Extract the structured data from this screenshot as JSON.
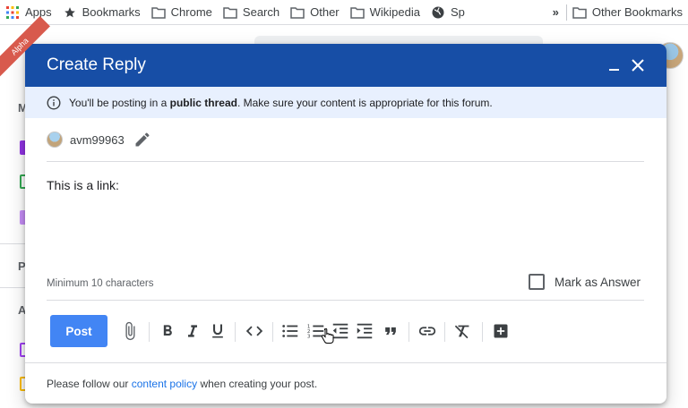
{
  "bookmarks": {
    "items": [
      {
        "label": "Apps",
        "icon": "apps-grid-icon"
      },
      {
        "label": "Bookmarks",
        "icon": "star-icon"
      },
      {
        "label": "Chrome",
        "icon": "folder-icon"
      },
      {
        "label": "Search",
        "icon": "folder-icon"
      },
      {
        "label": "Other",
        "icon": "folder-icon"
      },
      {
        "label": "Wikipedia",
        "icon": "folder-icon"
      },
      {
        "label": "Sp",
        "icon": "globe-icon"
      }
    ],
    "overflow": "»",
    "other_bookmarks": "Other Bookmarks"
  },
  "background": {
    "ribbon_text": "Alpha",
    "sidebar_letters": [
      "M",
      "P",
      "A"
    ],
    "peek_text": "· · · · · ·  · · · · ·  · · · · · · · · ·  · · ·  · · · · · · · · · · · · ·"
  },
  "dialog": {
    "title": "Create Reply",
    "notice": {
      "prefix": "You'll be posting in a ",
      "bold": "public thread",
      "suffix": ". Make sure your content is appropriate for this forum."
    },
    "author": "avm99963",
    "body_text": "This is a link:",
    "min_chars": "Minimum 10 characters",
    "mark_answer": "Mark as Answer",
    "post_label": "Post",
    "footer": {
      "prefix": "Please follow our ",
      "link": "content policy",
      "suffix": " when creating your post."
    }
  },
  "colors": {
    "header": "#174ea6",
    "notice_bg": "#e8f0fe",
    "post_button": "#4285f4",
    "link": "#1a73e8"
  }
}
